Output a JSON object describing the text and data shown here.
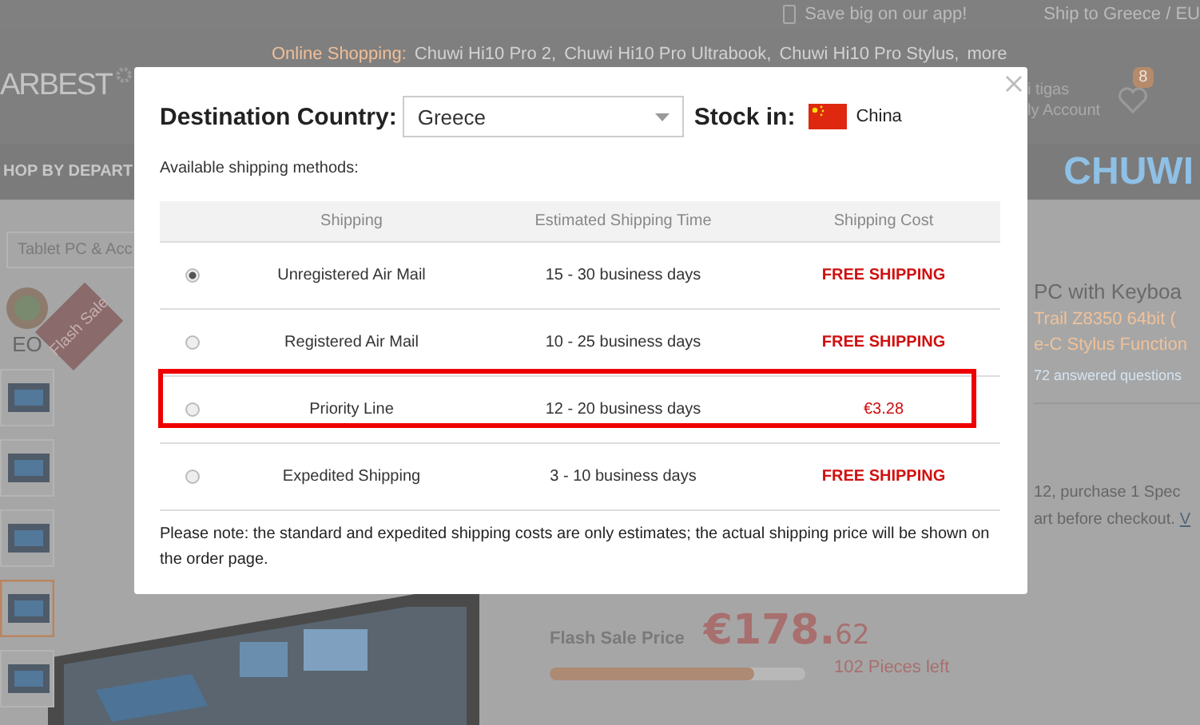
{
  "top_bar": {
    "app_promo": "Save big on our app!",
    "ship_to": "Ship to Greece / EU"
  },
  "header": {
    "logo": "ARBEST",
    "hot_label": "Online Shopping:",
    "hot_links": [
      "Chuwi Hi10 Pro 2,",
      "Chuwi Hi10 Pro Ultrabook,",
      "Chuwi Hi10 Pro Stylus,",
      "more"
    ],
    "account_greeting": "i tigas",
    "account_label": "ly Account",
    "wishlist_count": "8"
  },
  "nav": {
    "departments": "HOP BY DEPART",
    "brand_banner": "CHUWI"
  },
  "category_tab": "Tablet PC & Acc",
  "gallery": {
    "video_label": "EO",
    "ribbon": "Flash Sale",
    "thumbnails": [
      {
        "selected": false
      },
      {
        "selected": false
      },
      {
        "selected": false
      },
      {
        "selected": true
      },
      {
        "selected": false
      }
    ]
  },
  "product": {
    "title": "PC with Keyboa",
    "subtitle_lines": [
      "Trail Z8350 64bit (",
      "e-C Stylus Function"
    ],
    "questions": "72 answered questions",
    "promo_line": "12, purchase 1 Spec",
    "promo_text": "art before checkout.",
    "promo_link": "V"
  },
  "price": {
    "label": "Flash Sale Price",
    "main": "€178.",
    "cents": "62",
    "stock_left": "102 Pieces left",
    "level": 0.8
  },
  "dialog": {
    "destination_label": "Destination Country:",
    "destination_value": "Greece",
    "stock_label": "Stock in:",
    "stock_country": "China",
    "methods_label": "Available shipping methods:",
    "columns": [
      "Shipping",
      "Estimated Shipping Time",
      "Shipping Cost"
    ],
    "rows": [
      {
        "method": "Unregistered Air Mail",
        "time": "15 - 30 business days",
        "cost": "FREE SHIPPING",
        "kind": "free",
        "selected": true,
        "highlighted": false
      },
      {
        "method": "Registered Air Mail",
        "time": "10 - 25 business days",
        "cost": "FREE SHIPPING",
        "kind": "free",
        "selected": false,
        "highlighted": false
      },
      {
        "method": "Priority Line",
        "time": "12 - 20 business days",
        "cost": "€3.28",
        "kind": "paid",
        "selected": false,
        "highlighted": true
      },
      {
        "method": "Expedited Shipping",
        "time": "3 - 10 business days",
        "cost": "FREE SHIPPING",
        "kind": "free",
        "selected": false,
        "highlighted": false
      }
    ],
    "note": "Please note: the standard and expedited shipping costs are only estimates; the actual shipping price will be shown on the order page."
  }
}
